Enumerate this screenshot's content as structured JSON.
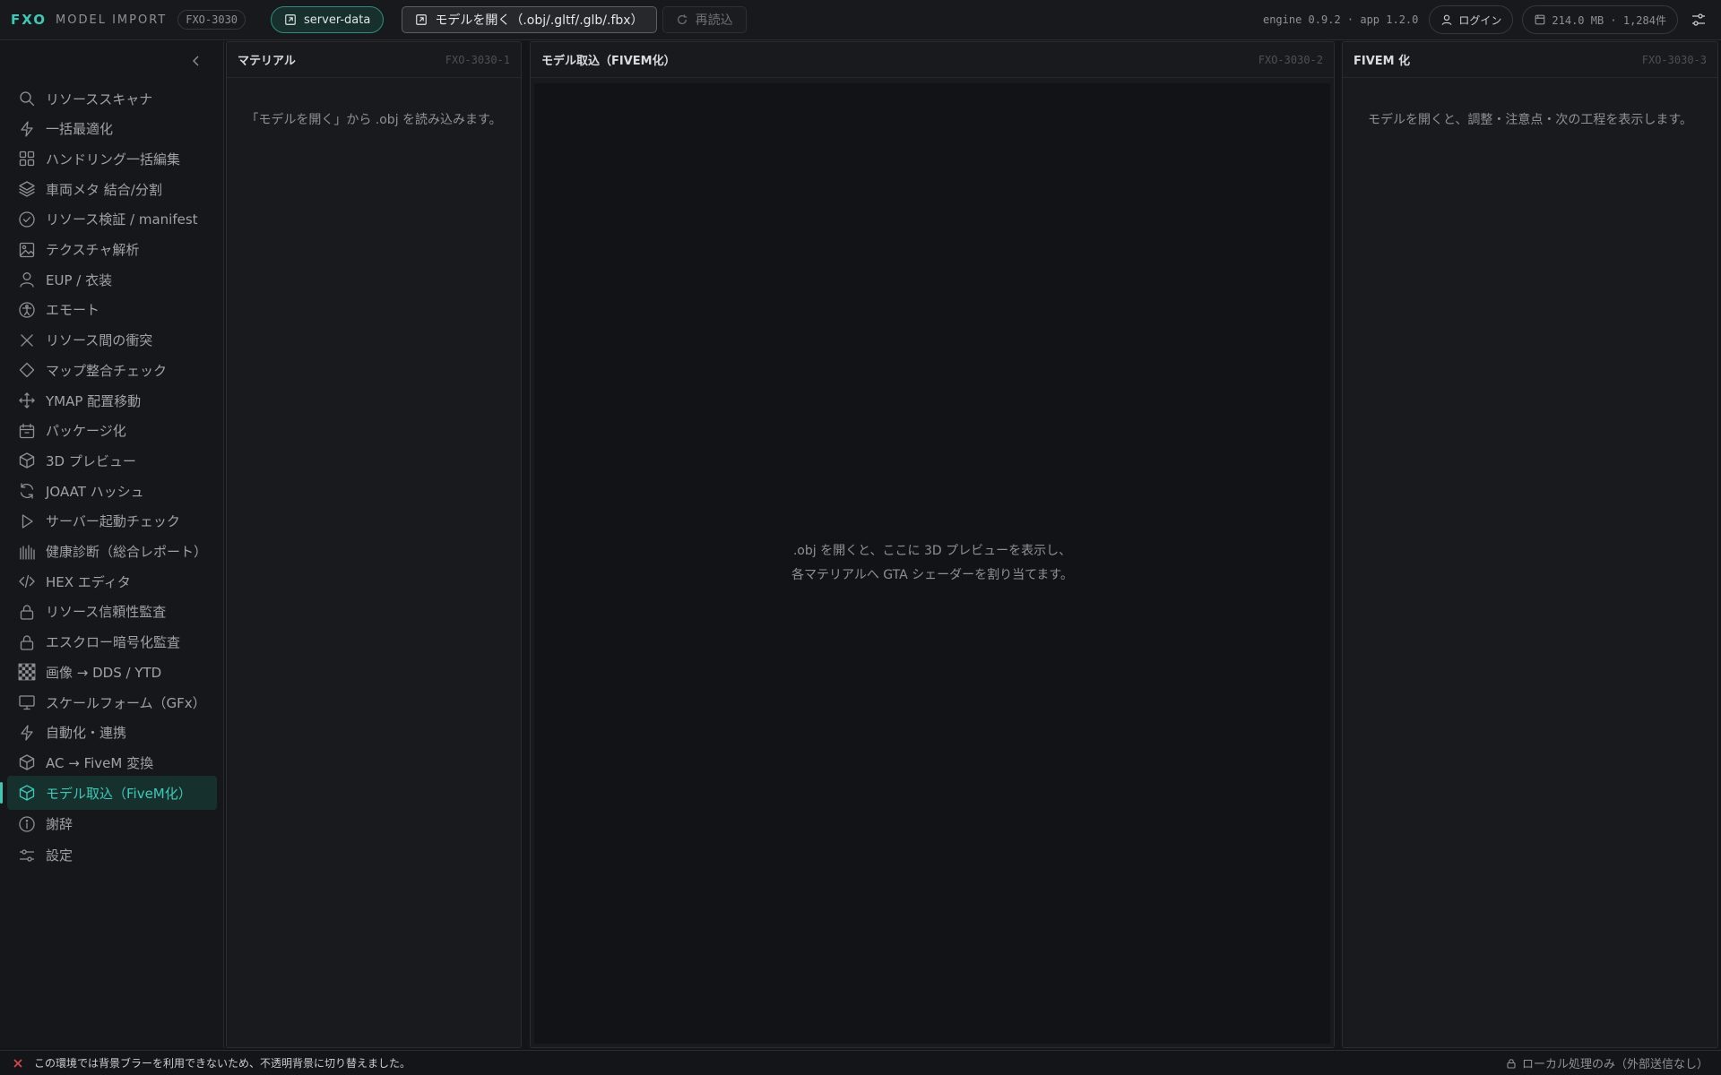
{
  "topbar": {
    "brand": "FXO",
    "subtitle": "MODEL IMPORT",
    "id_badge": "FXO-3030",
    "server_button": "server-data",
    "open_button": "モデルを開く（.obj/.gltf/.glb/.fbx）",
    "reload_button": "再読込",
    "engine_info": "engine 0.9.2 · app 1.2.0",
    "login_button": "ログイン",
    "storage_info": "214.0 MB · 1,284件"
  },
  "sidebar": {
    "items": [
      {
        "label": "リソーススキャナ",
        "icon": "search-icon"
      },
      {
        "label": "一括最適化",
        "icon": "bolt-icon"
      },
      {
        "label": "ハンドリング一括編集",
        "icon": "grid-icon"
      },
      {
        "label": "車両メタ 結合/分割",
        "icon": "layers-icon"
      },
      {
        "label": "リソース検証 / manifest",
        "icon": "check-circle-icon"
      },
      {
        "label": "テクスチャ解析",
        "icon": "image-icon"
      },
      {
        "label": "EUP / 衣装",
        "icon": "user-icon"
      },
      {
        "label": "エモート",
        "icon": "accessibility-icon"
      },
      {
        "label": "リソース間の衝突",
        "icon": "x-icon"
      },
      {
        "label": "マップ整合チェック",
        "icon": "diamond-icon"
      },
      {
        "label": "YMAP 配置移動",
        "icon": "move-icon"
      },
      {
        "label": "パッケージ化",
        "icon": "package-icon"
      },
      {
        "label": "3D プレビュー",
        "icon": "cube-icon"
      },
      {
        "label": "JOAAT ハッシュ",
        "icon": "refresh-icon"
      },
      {
        "label": "サーバー起動チェック",
        "icon": "play-icon"
      },
      {
        "label": "健康診断（総合レポート）",
        "icon": "bars-icon"
      },
      {
        "label": "HEX エディタ",
        "icon": "code-icon"
      },
      {
        "label": "リソース信頼性監査",
        "icon": "lock-icon"
      },
      {
        "label": "エスクロー暗号化監査",
        "icon": "lock-icon"
      },
      {
        "label": "画像 → DDS / YTD",
        "icon": "checker-icon"
      },
      {
        "label": "スケールフォーム（GFx）",
        "icon": "monitor-icon"
      },
      {
        "label": "自動化・連携",
        "icon": "bolt-icon"
      },
      {
        "label": "AC → FiveM 変換",
        "icon": "cube-icon"
      },
      {
        "label": "モデル取込（FiveM化）",
        "icon": "cube-icon"
      },
      {
        "label": "謝辞",
        "icon": "info-icon"
      },
      {
        "label": "設定",
        "icon": "sliders-icon"
      }
    ],
    "active_index": 23
  },
  "panels": {
    "material": {
      "title": "マテリアル",
      "id": "FXO-3030-1",
      "message": "「モデルを開く」から .obj を読み込みます。"
    },
    "import": {
      "title": "モデル取込（FIVEM化）",
      "id": "FXO-3030-2",
      "line1": ".obj を開くと、ここに 3D プレビューを表示し、",
      "line2": "各マテリアルへ GTA シェーダーを割り当てます。"
    },
    "fivem": {
      "title": "FIVEM 化",
      "id": "FXO-3030-3",
      "message": "モデルを開くと、調整・注意点・次の工程を表示します。"
    }
  },
  "statusbar": {
    "message": "この環境では背景ブラーを利用できないため、不透明背景に切り替えました。",
    "right": "ローカル処理のみ（外部送信なし）"
  },
  "colors": {
    "accent": "#3ec9b6",
    "error": "#e0464b"
  }
}
